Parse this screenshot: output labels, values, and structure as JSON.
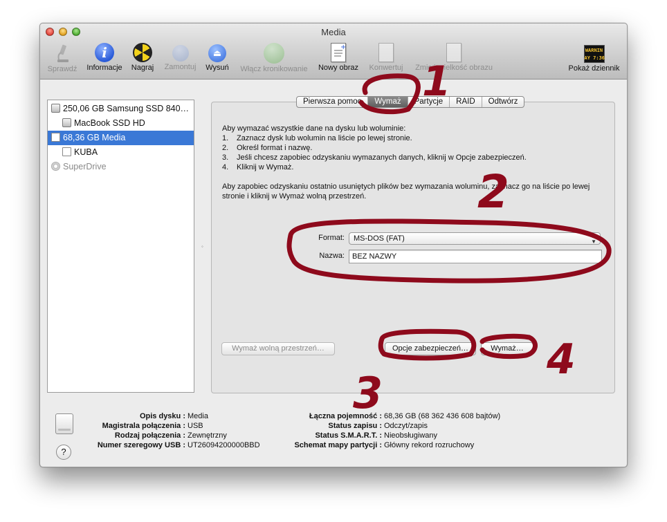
{
  "window": {
    "title": "Media"
  },
  "toolbar": {
    "items": [
      {
        "label": "Sprawdź",
        "icon": "microscope-icon",
        "enabled": false
      },
      {
        "label": "Informacje",
        "icon": "info-icon",
        "enabled": true
      },
      {
        "label": "Nagraj",
        "icon": "burn-icon",
        "enabled": true
      },
      {
        "label": "Zamontuj",
        "icon": "mount-icon",
        "enabled": false
      },
      {
        "label": "Wysuń",
        "icon": "eject-icon",
        "enabled": true
      },
      {
        "label": "Włącz kronikowanie",
        "icon": "journaling-icon",
        "enabled": false
      },
      {
        "label": "Nowy obraz",
        "icon": "new-image-icon",
        "enabled": true
      },
      {
        "label": "Konwertuj",
        "icon": "convert-icon",
        "enabled": false
      },
      {
        "label": "Zmień wielkość obrazu",
        "icon": "resize-image-icon",
        "enabled": false
      },
      {
        "label": "Pokaż dziennik",
        "icon": "log-icon",
        "enabled": true
      }
    ],
    "log_icon_text": [
      "WARNIN",
      "AY 7:36"
    ]
  },
  "sidebar": {
    "items": [
      {
        "label": "250,06 GB Samsung SSD 840…",
        "icon": "hard-disk-icon",
        "selected": false,
        "dim": false
      },
      {
        "label": "MacBook SSD HD",
        "icon": "hard-disk-icon",
        "selected": false,
        "dim": false
      },
      {
        "label": "68,36 GB Media",
        "icon": "external-disk-icon",
        "selected": true,
        "dim": false
      },
      {
        "label": "KUBA",
        "icon": "volume-icon",
        "selected": false,
        "dim": false
      },
      {
        "label": "SuperDrive",
        "icon": "optical-drive-icon",
        "selected": false,
        "dim": true
      }
    ]
  },
  "tabs": [
    {
      "label": "Pierwsza pomoc",
      "active": false
    },
    {
      "label": "Wymaż",
      "active": true
    },
    {
      "label": "Partycje",
      "active": false
    },
    {
      "label": "RAID",
      "active": false
    },
    {
      "label": "Odtwórz",
      "active": false
    }
  ],
  "erase": {
    "intro": "Aby wymazać wszystkie dane na dysku lub woluminie:",
    "steps": [
      {
        "num": "1.",
        "text": "Zaznacz dysk lub wolumin na liście po lewej stronie."
      },
      {
        "num": "2.",
        "text": "Określ format i nazwę."
      },
      {
        "num": "3.",
        "text": "Jeśli chcesz zapobiec odzyskaniu wymazanych danych, kliknij w Opcje zabezpieczeń."
      },
      {
        "num": "4.",
        "text": "Kliknij w Wymaż."
      }
    ],
    "note": "Aby zapobiec odzyskaniu ostatnio usuniętych plików bez wymazania woluminu, zaznacz go na liście po lewej stronie i kliknij w Wymaż wolną przestrzeń.",
    "format_label": "Format:",
    "format_value": "MS-DOS (FAT)",
    "name_label": "Nazwa:",
    "name_value": "BEZ NAZWY",
    "erase_free_space_button": "Wymaż wolną przestrzeń…",
    "security_options_button": "Opcje zabezpieczeń…",
    "erase_button": "Wymaż…"
  },
  "disk_info": {
    "left": [
      {
        "key": "Opis dysku :",
        "value": "Media"
      },
      {
        "key": "Magistrala połączenia :",
        "value": "USB"
      },
      {
        "key": "Rodzaj połączenia :",
        "value": "Zewnętrzny"
      },
      {
        "key": "Numer szeregowy USB :",
        "value": "UT26094200000BBD"
      }
    ],
    "right": [
      {
        "key": "Łączna pojemność :",
        "value": "68,36 GB (68 362 436 608 bajtów)"
      },
      {
        "key": "Status zapisu :",
        "value": "Odczyt/zapis"
      },
      {
        "key": "Status S.M.A.R.T. :",
        "value": "Nieobsługiwany"
      },
      {
        "key": "Schemat mapy partycji :",
        "value": "Główny rekord rozruchowy"
      }
    ],
    "help": "?"
  },
  "annotations": {
    "color": "#8e0a1c",
    "labels": [
      "1",
      "2",
      "3",
      "4"
    ]
  }
}
